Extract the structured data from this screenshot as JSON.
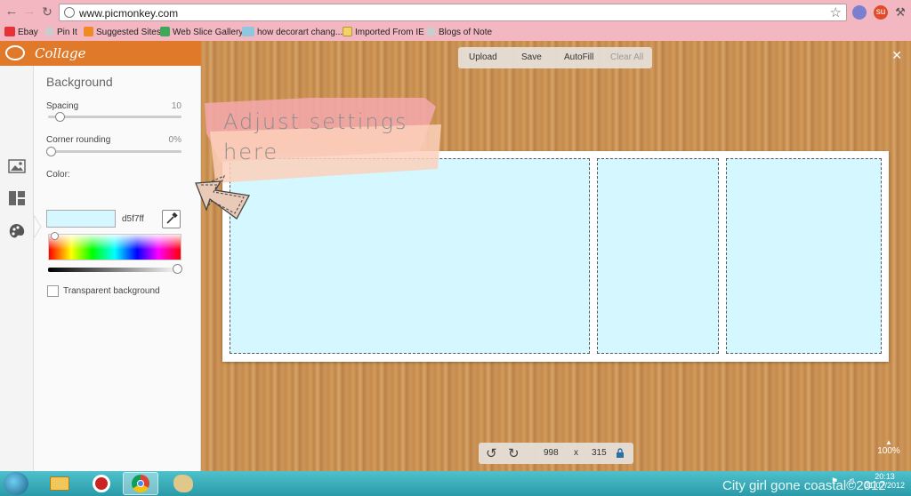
{
  "browser": {
    "url": "www.picmonkey.com",
    "bookmarks": [
      {
        "label": "Ebay"
      },
      {
        "label": "Pin It"
      },
      {
        "label": "Suggested Sites"
      },
      {
        "label": "Web Slice Gallery"
      },
      {
        "label": "how decorart chang..."
      },
      {
        "label": "Imported From IE"
      },
      {
        "label": "Blogs of Note"
      }
    ]
  },
  "panel": {
    "app_title": "Collage",
    "section_title": "Background",
    "spacing_label": "Spacing",
    "spacing_value": "10",
    "corner_label": "Corner rounding",
    "corner_value": "0%",
    "color_label": "Color:",
    "color_hex": "d5f7ff",
    "transparent_label": "Transparent background",
    "transparent_checked": false
  },
  "toolbar": {
    "upload": "Upload",
    "save": "Save",
    "autofill": "AutoFill",
    "clear_all": "Clear All"
  },
  "annotation": {
    "line1": "Adjust settings",
    "line2": "here"
  },
  "canvas": {
    "width_value": "998",
    "times": "x",
    "height_value": "315",
    "zoom": "100%",
    "background_color": "#d5f7ff"
  },
  "taskbar": {
    "time": "20:13",
    "date": "31/07/2012"
  },
  "watermark": "City girl gone coastal©2012",
  "colors": {
    "brand_orange": "#e07a2a",
    "chrome_pink": "#f2b7c0",
    "cell_fill": "#d5f7ff"
  },
  "icons": [
    "back-arrow-icon",
    "forward-arrow-icon",
    "globe-icon",
    "star-icon",
    "close-icon",
    "image-icon",
    "layout-icon",
    "palette-icon",
    "eyedropper-icon",
    "rotate-left-icon",
    "rotate-right-icon",
    "lock-icon"
  ]
}
